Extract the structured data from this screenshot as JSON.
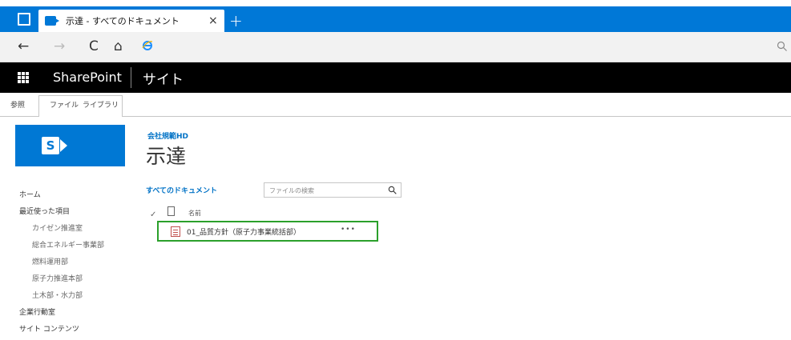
{
  "browser": {
    "tab_title": "示達 - すべてのドキュメント",
    "close_glyph": "×",
    "new_tab_glyph": "+",
    "back_glyph": "←",
    "forward_glyph": "→",
    "refresh_glyph": "C",
    "home_glyph": "⌂"
  },
  "suitebar": {
    "brand": "SharePoint",
    "site_label": "サイト"
  },
  "ribbon": {
    "tabs": [
      "参照",
      "ファイル",
      "ライブラリ"
    ]
  },
  "site": {
    "breadcrumb": "会社規範HD",
    "title": "示達"
  },
  "leftnav": {
    "items": [
      {
        "label": "ホーム"
      },
      {
        "label": "最近使った項目"
      },
      {
        "label": "カイゼン推進室"
      },
      {
        "label": "総合エネルギー事業部"
      },
      {
        "label": "燃料運用部"
      },
      {
        "label": "原子力推進本部"
      },
      {
        "label": "土木部・水力部"
      },
      {
        "label": "企業行動室"
      },
      {
        "label": "サイト コンテンツ"
      }
    ]
  },
  "library": {
    "view_label": "すべてのドキュメント",
    "search_placeholder": "ファイルの検索",
    "check_glyph": "✓",
    "column_name": "名前",
    "files": [
      {
        "name": "01_品質方針（原子力事業統括部）",
        "more": "•••"
      }
    ]
  },
  "colors": {
    "tab_bar": "#0078d7",
    "suite_bar": "#000000",
    "link_blue": "#0072c6",
    "highlight_green": "#2ba02b"
  }
}
